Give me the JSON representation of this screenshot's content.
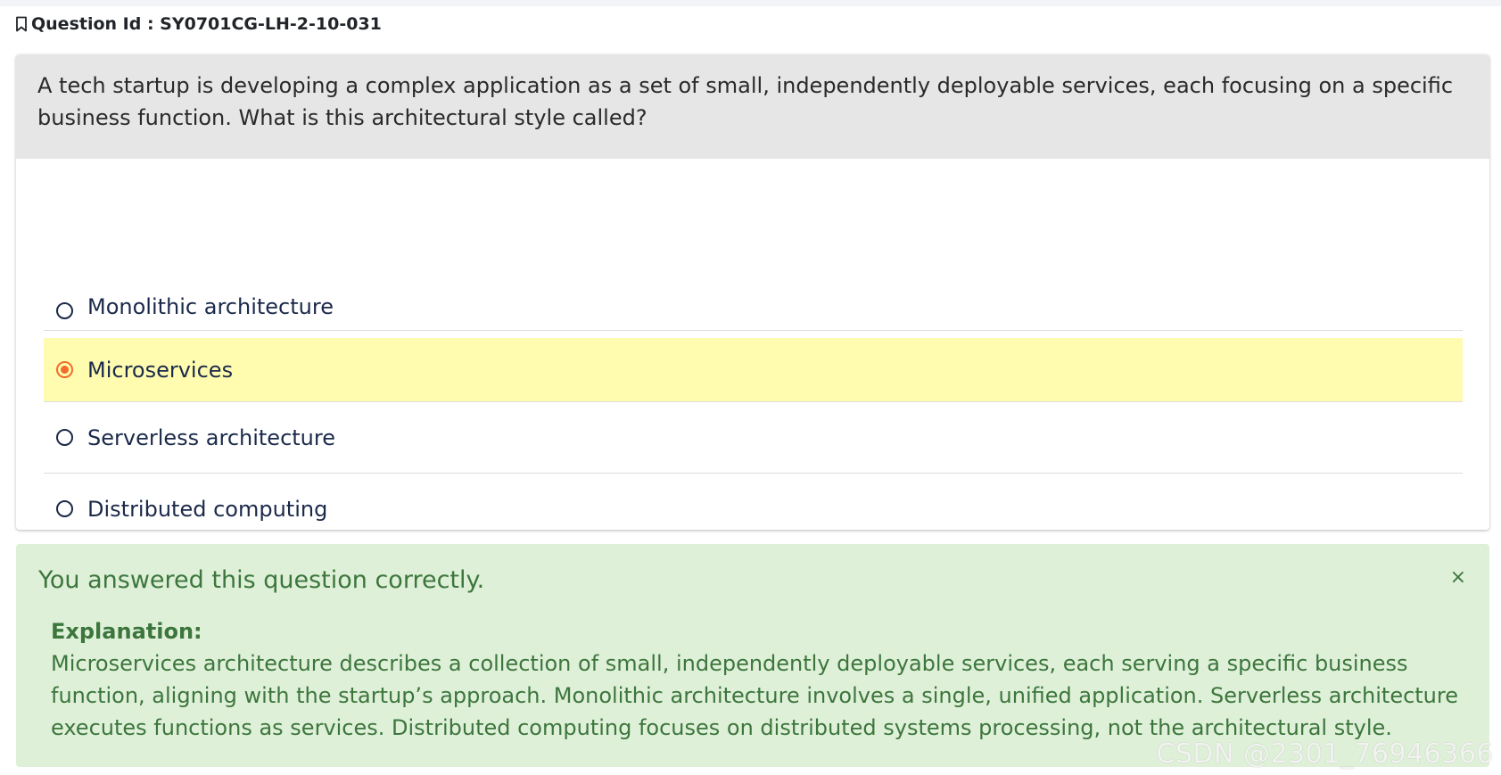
{
  "question": {
    "id_label": "Question Id : SY0701CG-LH-2-10-031",
    "stem": "A tech startup is developing a complex application as a set of small, independently deployable services, each focusing on a specific business function. What is this architectural style called?",
    "options": [
      {
        "label": "Monolithic architecture",
        "selected": false
      },
      {
        "label": "Microservices",
        "selected": true
      },
      {
        "label": "Serverless architecture",
        "selected": false
      },
      {
        "label": "Distributed computing",
        "selected": false
      }
    ]
  },
  "feedback": {
    "title": "You answered this question correctly.",
    "close_symbol": "×",
    "explanation_label": "Explanation:",
    "explanation_text": "Microservices architecture describes a collection of small, independently deployable services, each serving a specific business function, aligning with the startup’s approach. Monolithic architecture involves a single, unified application. Serverless architecture executes functions as services. Distributed computing focuses on distributed systems processing, not the architectural style."
  },
  "watermark": "CSDN @2301_76946366",
  "colors": {
    "stem_bg": "#e6e6e6",
    "selected_bg": "#fffcb0",
    "radio_selected": "#f26b2b",
    "success_bg": "#dff0d8",
    "success_text": "#3c763d"
  },
  "icons": {
    "question_id": "bookmark-icon",
    "radio_unchecked": "radio-unchecked-icon",
    "radio_checked": "radio-checked-icon",
    "close": "close-icon"
  }
}
